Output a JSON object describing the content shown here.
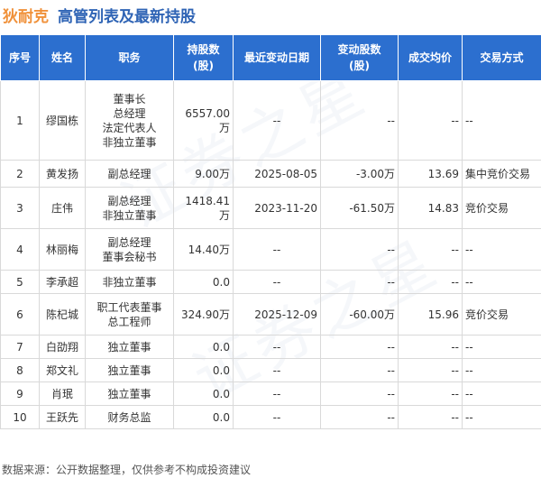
{
  "header": {
    "company": "狄耐克",
    "title": "高管列表及最新持股"
  },
  "watermark": "证券之星",
  "columns": [
    "序号",
    "姓名",
    "职务",
    "持股数\n(股)",
    "最近变动日期",
    "变动股数\n(股)",
    "成交均价",
    "交易方式"
  ],
  "rows": [
    {
      "no": "1",
      "name": "缪国栋",
      "roles": [
        "董事长",
        "总经理",
        "法定代表人",
        "非独立董事"
      ],
      "shares": "6557.00万",
      "date": "--",
      "change": "--",
      "price": "--",
      "method": "--"
    },
    {
      "no": "2",
      "name": "黄发扬",
      "roles": [
        "副总经理"
      ],
      "shares": "9.00万",
      "date": "2025-08-05",
      "change": "-3.00万",
      "price": "13.69",
      "method": "集中竞价交易"
    },
    {
      "no": "3",
      "name": "庄伟",
      "roles": [
        "副总经理",
        "非独立董事"
      ],
      "shares": "1418.41万",
      "date": "2023-11-20",
      "change": "-61.50万",
      "price": "14.83",
      "method": "竞价交易"
    },
    {
      "no": "4",
      "name": "林丽梅",
      "roles": [
        "副总经理",
        "董事会秘书"
      ],
      "shares": "14.40万",
      "date": "--",
      "change": "--",
      "price": "--",
      "method": "--"
    },
    {
      "no": "5",
      "name": "李承超",
      "roles": [
        "非独立董事"
      ],
      "shares": "0.0",
      "date": "--",
      "change": "--",
      "price": "--",
      "method": "--"
    },
    {
      "no": "6",
      "name": "陈杞城",
      "roles": [
        "职工代表董事",
        "总工程师"
      ],
      "shares": "324.90万",
      "date": "2025-12-09",
      "change": "-60.00万",
      "price": "15.96",
      "method": "竞价交易"
    },
    {
      "no": "7",
      "name": "白劭翔",
      "roles": [
        "独立董事"
      ],
      "shares": "0.0",
      "date": "--",
      "change": "--",
      "price": "--",
      "method": "--"
    },
    {
      "no": "8",
      "name": "郑文礼",
      "roles": [
        "独立董事"
      ],
      "shares": "0.0",
      "date": "--",
      "change": "--",
      "price": "--",
      "method": "--"
    },
    {
      "no": "9",
      "name": "肖珉",
      "roles": [
        "独立董事"
      ],
      "shares": "0.0",
      "date": "--",
      "change": "--",
      "price": "--",
      "method": "--"
    },
    {
      "no": "10",
      "name": "王跃先",
      "roles": [
        "财务总监"
      ],
      "shares": "0.0",
      "date": "--",
      "change": "--",
      "price": "--",
      "method": "--"
    }
  ],
  "footer": "数据来源：公开数据整理，仅供参考不构成投资建议",
  "colors": {
    "header_bg": "#2c6fcf",
    "company": "#f0913a",
    "title": "#2f64b5",
    "change_value": "#1e9b3a"
  }
}
